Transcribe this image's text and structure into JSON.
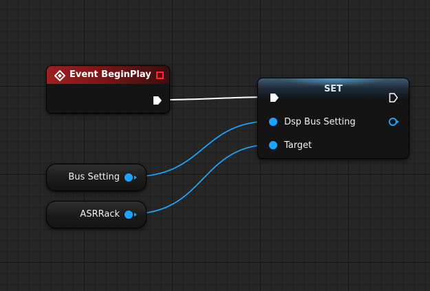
{
  "graph": {
    "event_node": {
      "title": "Event BeginPlay",
      "icon": "event-diamond-icon"
    },
    "set_node": {
      "title": "SET",
      "inputs": [
        {
          "label": "Dsp Bus Setting"
        },
        {
          "label": "Target"
        }
      ]
    },
    "variables": [
      {
        "label": "Bus Setting"
      },
      {
        "label": "ASRRack"
      }
    ]
  },
  "colors": {
    "exec_wire": "#ffffff",
    "object_pin": "#1aa3ff",
    "event_header": "#9c2020",
    "delegate_pin": "#ff2a2a"
  }
}
